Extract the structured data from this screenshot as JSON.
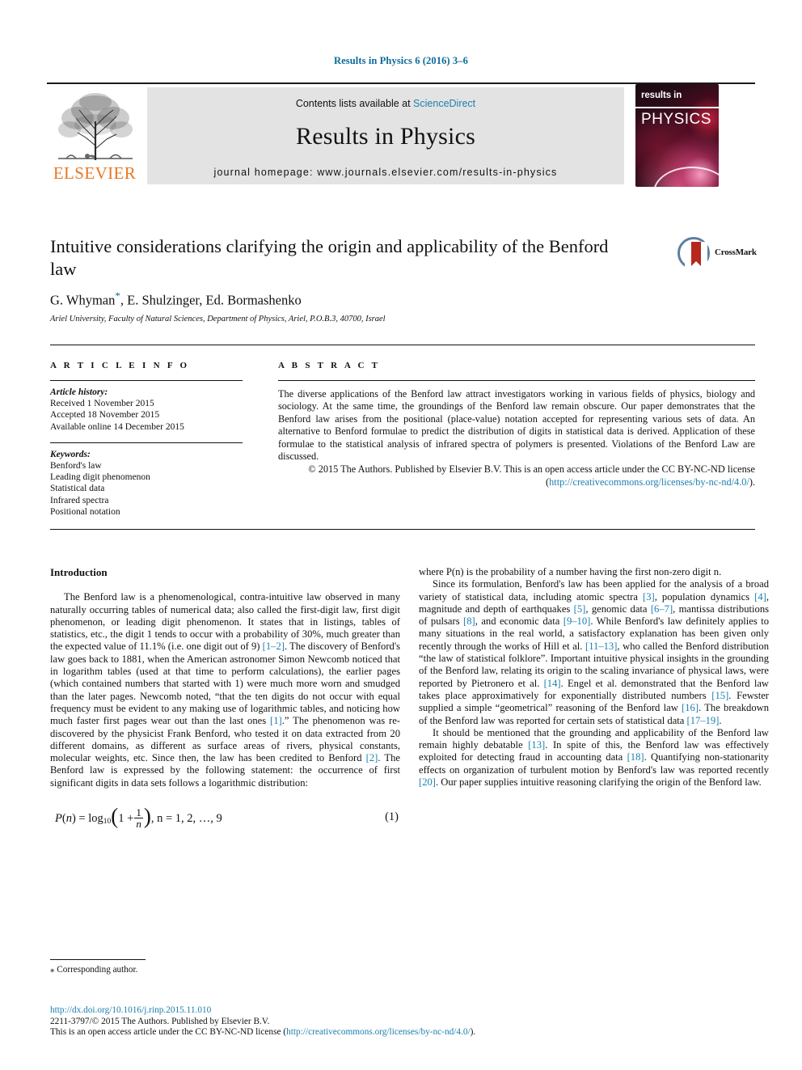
{
  "running_head": "Results in Physics 6 (2016) 3–6",
  "masthead": {
    "contents_prefix": "Contents lists available at ",
    "contents_link": "ScienceDirect",
    "journal_name": "Results in Physics",
    "homepage": "journal homepage: www.journals.elsevier.com/results-in-physics",
    "publisher_word": "ELSEVIER",
    "cover": {
      "line1": "results in",
      "line2": "PHYSICS"
    }
  },
  "article": {
    "title": "Intuitive considerations clarifying the origin and applicability of the Benford law",
    "authors_html": "G. Whyman<sup>*</sup>, E. Shulzinger, Ed. Bormashenko",
    "affiliation": "Ariel University, Faculty of Natural Sciences, Department of Physics, Ariel, P.O.B.3, 40700, Israel",
    "crossmark_label": "CrossMark"
  },
  "info": {
    "heading": "A R T I C L E   I N F O",
    "history_label": "Article history:",
    "history": [
      "Received 1 November 2015",
      "Accepted 18 November 2015",
      "Available online 14 December 2015"
    ],
    "keywords_label": "Keywords:",
    "keywords": [
      "Benford's law",
      "Leading digit phenomenon",
      "Statistical data",
      "Infrared spectra",
      "Positional notation"
    ]
  },
  "abstract": {
    "heading": "A B S T R A C T",
    "text": "The diverse applications of the Benford law attract investigators working in various fields of physics, biology and sociology. At the same time, the groundings of the Benford law remain obscure. Our paper demonstrates that the Benford law arises from the positional (place-value) notation accepted for representing various sets of data. An alternative to Benford formulae to predict the distribution of digits in statistical data is derived. Application of these formulae to the statistical analysis of infrared spectra of polymers is presented. Violations of the Benford Law are discussed.",
    "copyright": "© 2015 The Authors. Published by Elsevier B.V. This is an open access article under the CC BY-NC-ND license (",
    "license_url": "http://creativecommons.org/licenses/by-nc-nd/4.0/",
    "copyright_tail": ")."
  },
  "body": {
    "section_heading": "Introduction",
    "left": {
      "p1_a": "The Benford law is a phenomenological, contra-intuitive law observed in many naturally occurring tables of numerical data; also called the first-digit law, first digit phenomenon, or leading digit phenomenon. It states that in listings, tables of statistics, etc., the digit 1 tends to occur with a probability of 30%, much greater than the expected value of 11.1% (i.e. one digit out of 9) ",
      "r1": "[1–2]",
      "p1_b": ". The discovery of Benford's law goes back to 1881, when the American astronomer Simon Newcomb noticed that in logarithm tables (used at that time to perform calculations), the earlier pages (which contained numbers that started with 1) were much more worn and smudged than the later pages. Newcomb noted, “that the ten digits do not occur with equal frequency must be evident to any making use of logarithmic tables, and noticing how much faster first pages wear out than the last ones ",
      "r2": "[1]",
      "p1_c": ".” The phenomenon was re-discovered by the physicist Frank Benford, who tested it on data extracted from 20 different domains, as different as surface areas of rivers, physical constants, molecular weights, etc. Since then, the law has been credited to Benford ",
      "r3": "[2]",
      "p1_d": ". The Benford law is expressed by the following statement: the occurrence of first significant digits in data sets follows a logarithmic distribution:"
    },
    "equation": {
      "lhs": "P(n) = log",
      "base": "10",
      "inner_num": "1",
      "inner_den": "n",
      "inner_prefix": "1 +",
      "tail": ",   n = 1, 2, …, 9",
      "number": "(1)"
    },
    "right": {
      "p1": "where P(n) is the probability of a number having the first non-zero digit n.",
      "p2_a": "Since its formulation, Benford's law has been applied for the analysis of a broad variety of statistical data, including atomic spectra ",
      "r3": "[3]",
      "p2_b": ", population dynamics ",
      "r4": "[4]",
      "p2_c": ", magnitude and depth of earthquakes ",
      "r5": "[5]",
      "p2_d": ", genomic data ",
      "r67": "[6–7]",
      "p2_e": ", mantissa distributions of pulsars ",
      "r8": "[8]",
      "p2_f": ", and economic data ",
      "r910": "[9–10]",
      "p2_g": ". While Benford's law definitely applies to many situations in the real world, a satisfactory explanation has been given only recently through the works of Hill et al. ",
      "r1113": "[11–13]",
      "p2_h": ", who called the Benford distribution “the law of statistical folklore”. Important intuitive physical insights in the grounding of the Benford law, relating its origin to the scaling invariance of physical laws, were reported by Pietronero et al. ",
      "r14": "[14]",
      "p2_i": ". Engel et al. demonstrated that the Benford law takes place approximatively for exponentially distributed numbers ",
      "r15": "[15]",
      "p2_j": ". Fewster supplied a simple “geometrical” reasoning of the Benford law ",
      "r16": "[16]",
      "p2_k": ". The breakdown of the Benford law was reported for certain sets of statistical data ",
      "r1719": "[17–19]",
      "p2_l": ".",
      "p3_a": "It should be mentioned that the grounding and applicability of the Benford law remain highly debatable ",
      "r13": "[13]",
      "p3_b": ". In spite of this, the Benford law was effectively exploited for detecting fraud in accounting data ",
      "r18": "[18]",
      "p3_c": ". Quantifying non-stationarity effects on organization of turbulent motion by Benford's law was reported recently ",
      "r20": "[20]",
      "p3_d": ". Our paper supplies intuitive reasoning clarifying the origin of the Benford law."
    }
  },
  "footnote": {
    "marker": "⁎",
    "text": "Corresponding author."
  },
  "footer": {
    "doi": "http://dx.doi.org/10.1016/j.rinp.2015.11.010",
    "issn_line": "2211-3797/© 2015 The Authors. Published by Elsevier B.V.",
    "license_prefix": "This is an open access article under the CC BY-NC-ND license (",
    "license_url": "http://creativecommons.org/licenses/by-nc-nd/4.0/",
    "license_tail": ")."
  },
  "colors": {
    "link": "#1b7fb0",
    "running_head": "#0b6a99",
    "elsevier_orange": "#e87722",
    "masthead_bg": "#e3e3e3"
  }
}
